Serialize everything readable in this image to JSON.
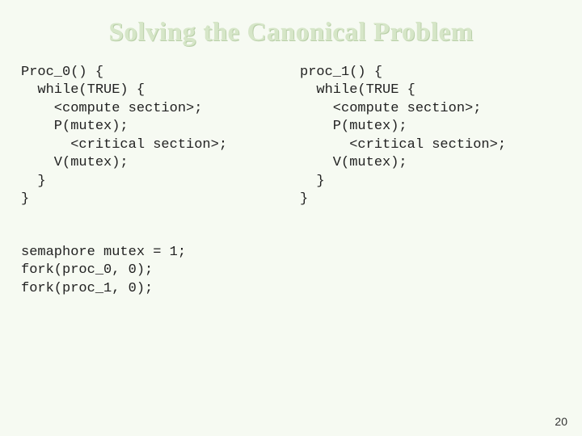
{
  "title": "Solving the Canonical Problem",
  "left_code": "Proc_0() {\n  while(TRUE) {\n    <compute section>;\n    P(mutex);\n      <critical section>;\n    V(mutex);\n  }\n}",
  "right_code": "proc_1() {\n  while(TRUE {\n    <compute section>;\n    P(mutex);\n      <critical section>;\n    V(mutex);\n  }\n}",
  "footer_code": "semaphore mutex = 1;\nfork(proc_0, 0);\nfork(proc_1, 0);",
  "page_number": "20"
}
